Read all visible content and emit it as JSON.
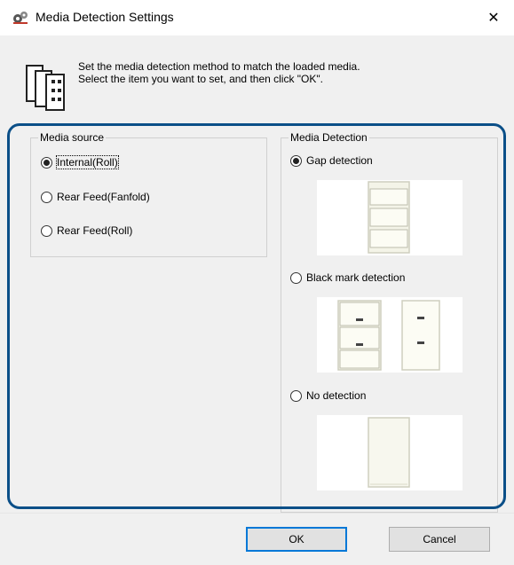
{
  "window": {
    "title": "Media Detection Settings",
    "close_symbol": "✕"
  },
  "intro": {
    "line1": "Set the media detection method to match the loaded media.",
    "line2": "Select the item you want to set, and then click \"OK\"."
  },
  "media_source": {
    "legend": "Media source",
    "options": [
      {
        "label": "Internal(Roll)",
        "checked": true
      },
      {
        "label": "Rear Feed(Fanfold)",
        "checked": false
      },
      {
        "label": "Rear Feed(Roll)",
        "checked": false
      }
    ]
  },
  "media_detection": {
    "legend": "Media Detection",
    "options": [
      {
        "label": "Gap detection",
        "checked": true,
        "image": "gap-label-illustration"
      },
      {
        "label": "Black mark detection",
        "checked": false,
        "image": "black-mark-illustration"
      },
      {
        "label": "No detection",
        "checked": false,
        "image": "continuous-paper-illustration"
      }
    ]
  },
  "buttons": {
    "ok": "OK",
    "cancel": "Cancel"
  },
  "colors": {
    "highlight_border": "#0b4f88",
    "default_button_border": "#0078d7",
    "paper": "#f4f4e8"
  }
}
